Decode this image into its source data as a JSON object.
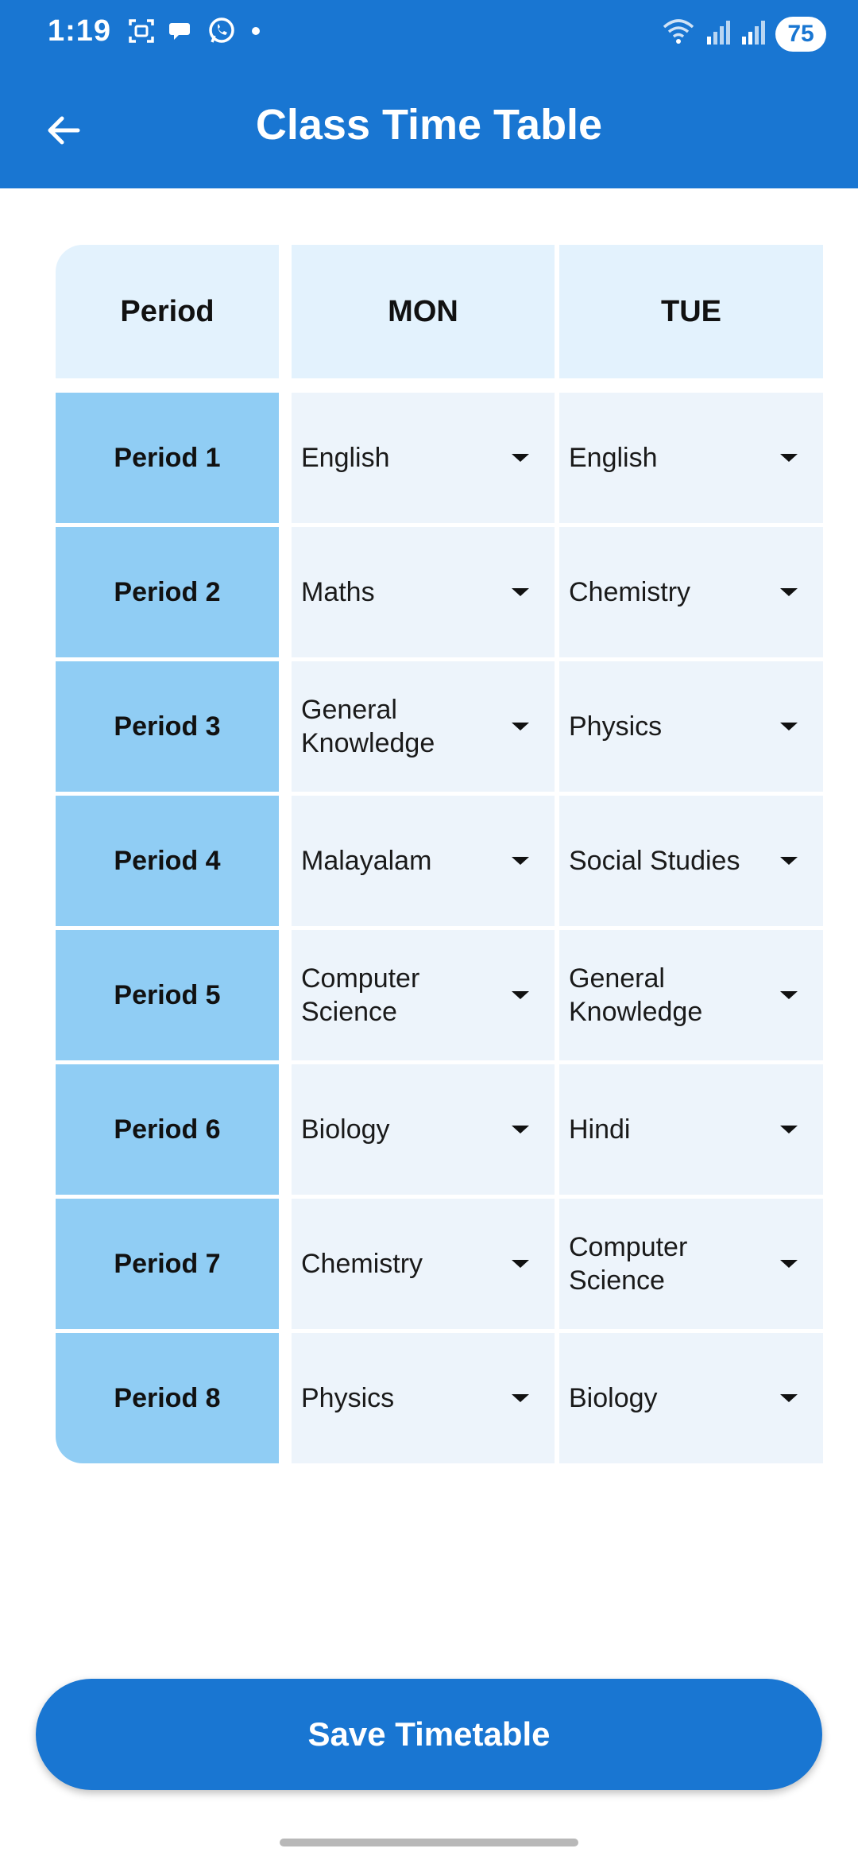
{
  "status_bar": {
    "time": "1:19",
    "battery": "75",
    "left_icons": [
      "screenshot-icon",
      "chat-bubbles-icon",
      "whatsapp-icon",
      "dot-icon"
    ],
    "right_icons": [
      "wifi-icon",
      "signal-icon",
      "signal-icon",
      "battery-icon"
    ]
  },
  "app_bar": {
    "title": "Class Time Table",
    "back_icon": "arrow-left-icon",
    "background": "#1976d2"
  },
  "table": {
    "headers": [
      "Period",
      "MON",
      "TUE"
    ],
    "rows": [
      {
        "period": "Period 1",
        "mon": "English",
        "tue": "English"
      },
      {
        "period": "Period 2",
        "mon": "Maths",
        "tue": "Chemistry"
      },
      {
        "period": "Period 3",
        "mon": "General Knowledge",
        "tue": "Physics"
      },
      {
        "period": "Period 4",
        "mon": "Malayalam",
        "tue": "Social Studies"
      },
      {
        "period": "Period 5",
        "mon": "Computer Science",
        "tue": "General Knowledge"
      },
      {
        "period": "Period 6",
        "mon": "Biology",
        "tue": "Hindi"
      },
      {
        "period": "Period 7",
        "mon": "Chemistry",
        "tue": "Computer Science"
      },
      {
        "period": "Period 8",
        "mon": "Physics",
        "tue": "Biology"
      }
    ],
    "colors": {
      "header_bg": "#e3f2fd",
      "period_bg": "#90cdf4",
      "cell_bg": "#edf4fb"
    }
  },
  "save_button": {
    "label": "Save Timetable",
    "color": "#1976d2"
  }
}
